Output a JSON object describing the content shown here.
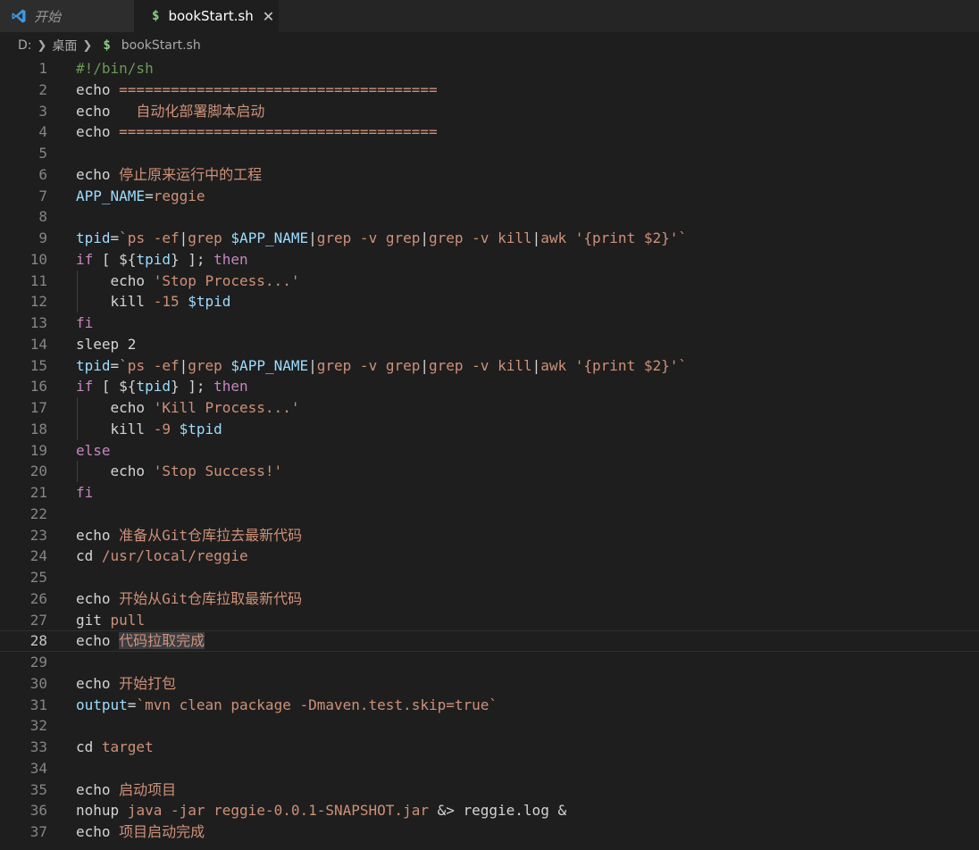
{
  "tabs": [
    {
      "label": "开始",
      "active": false
    },
    {
      "label": "bookStart.sh",
      "active": true,
      "close": "✕"
    }
  ],
  "breadcrumb": {
    "drive": "D:",
    "folder": "桌面",
    "file": "bookStart.sh"
  },
  "editor": {
    "current_line": 28,
    "lines": [
      {
        "n": "1",
        "indent": false,
        "tokens": [
          [
            "#!/bin/sh",
            "cmt"
          ]
        ]
      },
      {
        "n": "2",
        "indent": false,
        "tokens": [
          [
            "echo",
            "txt"
          ],
          [
            " =====================================",
            "str"
          ]
        ]
      },
      {
        "n": "3",
        "indent": false,
        "tokens": [
          [
            "echo",
            "txt"
          ],
          [
            "   自动化部署脚本启动",
            "str"
          ]
        ]
      },
      {
        "n": "4",
        "indent": false,
        "tokens": [
          [
            "echo",
            "txt"
          ],
          [
            " =====================================",
            "str"
          ]
        ]
      },
      {
        "n": "5",
        "indent": false,
        "tokens": []
      },
      {
        "n": "6",
        "indent": false,
        "tokens": [
          [
            "echo",
            "txt"
          ],
          [
            " 停止原来运行中的工程",
            "str"
          ]
        ]
      },
      {
        "n": "7",
        "indent": false,
        "tokens": [
          [
            "APP_NAME",
            "var"
          ],
          [
            "=",
            "op"
          ],
          [
            "reggie",
            "str"
          ]
        ]
      },
      {
        "n": "8",
        "indent": false,
        "tokens": []
      },
      {
        "n": "9",
        "indent": false,
        "tokens": [
          [
            "tpid",
            "var"
          ],
          [
            "=",
            "op"
          ],
          [
            "`ps -ef",
            "str"
          ],
          [
            "|",
            "op"
          ],
          [
            "grep ",
            "str"
          ],
          [
            "$APP_NAME",
            "var"
          ],
          [
            "|",
            "op"
          ],
          [
            "grep -v grep",
            "str"
          ],
          [
            "|",
            "op"
          ],
          [
            "grep -v kill",
            "str"
          ],
          [
            "|",
            "op"
          ],
          [
            "awk '{print $2}'`",
            "str"
          ]
        ]
      },
      {
        "n": "10",
        "indent": false,
        "tokens": [
          [
            "if",
            "kw"
          ],
          [
            " [ ",
            "op"
          ],
          [
            "${",
            "op"
          ],
          [
            "tpid",
            "var"
          ],
          [
            "}",
            "op"
          ],
          [
            " ]; ",
            "op"
          ],
          [
            "then",
            "kw"
          ]
        ]
      },
      {
        "n": "11",
        "indent": true,
        "tokens": [
          [
            "    echo",
            "txt"
          ],
          [
            " 'Stop Process...'",
            "str"
          ]
        ]
      },
      {
        "n": "12",
        "indent": true,
        "tokens": [
          [
            "    kill",
            "txt"
          ],
          [
            " -15 ",
            "str"
          ],
          [
            "$tpid",
            "var"
          ]
        ]
      },
      {
        "n": "13",
        "indent": false,
        "tokens": [
          [
            "fi",
            "kw"
          ]
        ]
      },
      {
        "n": "14",
        "indent": false,
        "tokens": [
          [
            "sleep",
            "txt"
          ],
          [
            " 2",
            "txt"
          ]
        ]
      },
      {
        "n": "15",
        "indent": false,
        "tokens": [
          [
            "tpid",
            "var"
          ],
          [
            "=",
            "op"
          ],
          [
            "`ps -ef",
            "str"
          ],
          [
            "|",
            "op"
          ],
          [
            "grep ",
            "str"
          ],
          [
            "$APP_NAME",
            "var"
          ],
          [
            "|",
            "op"
          ],
          [
            "grep -v grep",
            "str"
          ],
          [
            "|",
            "op"
          ],
          [
            "grep -v kill",
            "str"
          ],
          [
            "|",
            "op"
          ],
          [
            "awk '{print $2}'`",
            "str"
          ]
        ]
      },
      {
        "n": "16",
        "indent": false,
        "tokens": [
          [
            "if",
            "kw"
          ],
          [
            " [ ",
            "op"
          ],
          [
            "${",
            "op"
          ],
          [
            "tpid",
            "var"
          ],
          [
            "}",
            "op"
          ],
          [
            " ]; ",
            "op"
          ],
          [
            "then",
            "kw"
          ]
        ]
      },
      {
        "n": "17",
        "indent": true,
        "tokens": [
          [
            "    echo",
            "txt"
          ],
          [
            " 'Kill Process...'",
            "str"
          ]
        ]
      },
      {
        "n": "18",
        "indent": true,
        "tokens": [
          [
            "    kill",
            "txt"
          ],
          [
            " -9 ",
            "str"
          ],
          [
            "$tpid",
            "var"
          ]
        ]
      },
      {
        "n": "19",
        "indent": false,
        "tokens": [
          [
            "else",
            "kw"
          ]
        ]
      },
      {
        "n": "20",
        "indent": true,
        "tokens": [
          [
            "    echo",
            "txt"
          ],
          [
            " 'Stop Success!'",
            "str"
          ]
        ]
      },
      {
        "n": "21",
        "indent": false,
        "tokens": [
          [
            "fi",
            "kw"
          ]
        ]
      },
      {
        "n": "22",
        "indent": false,
        "tokens": []
      },
      {
        "n": "23",
        "indent": false,
        "tokens": [
          [
            "echo",
            "txt"
          ],
          [
            " 准备从Git仓库拉去最新代码",
            "str"
          ]
        ]
      },
      {
        "n": "24",
        "indent": false,
        "tokens": [
          [
            "cd",
            "txt"
          ],
          [
            " /usr/local/reggie",
            "str"
          ]
        ]
      },
      {
        "n": "25",
        "indent": false,
        "tokens": []
      },
      {
        "n": "26",
        "indent": false,
        "tokens": [
          [
            "echo",
            "txt"
          ],
          [
            " 开始从Git仓库拉取最新代码",
            "str"
          ]
        ]
      },
      {
        "n": "27",
        "indent": false,
        "tokens": [
          [
            "git",
            "txt"
          ],
          [
            " pull",
            "str"
          ]
        ]
      },
      {
        "n": "28",
        "indent": false,
        "tokens": [
          [
            "echo",
            "txt"
          ],
          [
            " ",
            "txt"
          ],
          [
            "代码拉取完成",
            "hl"
          ]
        ]
      },
      {
        "n": "29",
        "indent": false,
        "tokens": []
      },
      {
        "n": "30",
        "indent": false,
        "tokens": [
          [
            "echo",
            "txt"
          ],
          [
            " 开始打包",
            "str"
          ]
        ]
      },
      {
        "n": "31",
        "indent": false,
        "tokens": [
          [
            "output",
            "var"
          ],
          [
            "=",
            "op"
          ],
          [
            "`mvn clean package -Dmaven.test.skip=true`",
            "str"
          ]
        ]
      },
      {
        "n": "32",
        "indent": false,
        "tokens": []
      },
      {
        "n": "33",
        "indent": false,
        "tokens": [
          [
            "cd",
            "txt"
          ],
          [
            " target",
            "str"
          ]
        ]
      },
      {
        "n": "34",
        "indent": false,
        "tokens": []
      },
      {
        "n": "35",
        "indent": false,
        "tokens": [
          [
            "echo",
            "txt"
          ],
          [
            " 启动项目",
            "str"
          ]
        ]
      },
      {
        "n": "36",
        "indent": false,
        "tokens": [
          [
            "nohup",
            "txt"
          ],
          [
            " java -jar reggie-0.0.1-SNAPSHOT.jar ",
            "str"
          ],
          [
            "&>",
            "op"
          ],
          [
            " reggie.log ",
            "txt"
          ],
          [
            "&",
            "op"
          ]
        ]
      },
      {
        "n": "37",
        "indent": false,
        "tokens": [
          [
            "echo",
            "txt"
          ],
          [
            " 项目启动完成",
            "str"
          ]
        ]
      }
    ]
  }
}
